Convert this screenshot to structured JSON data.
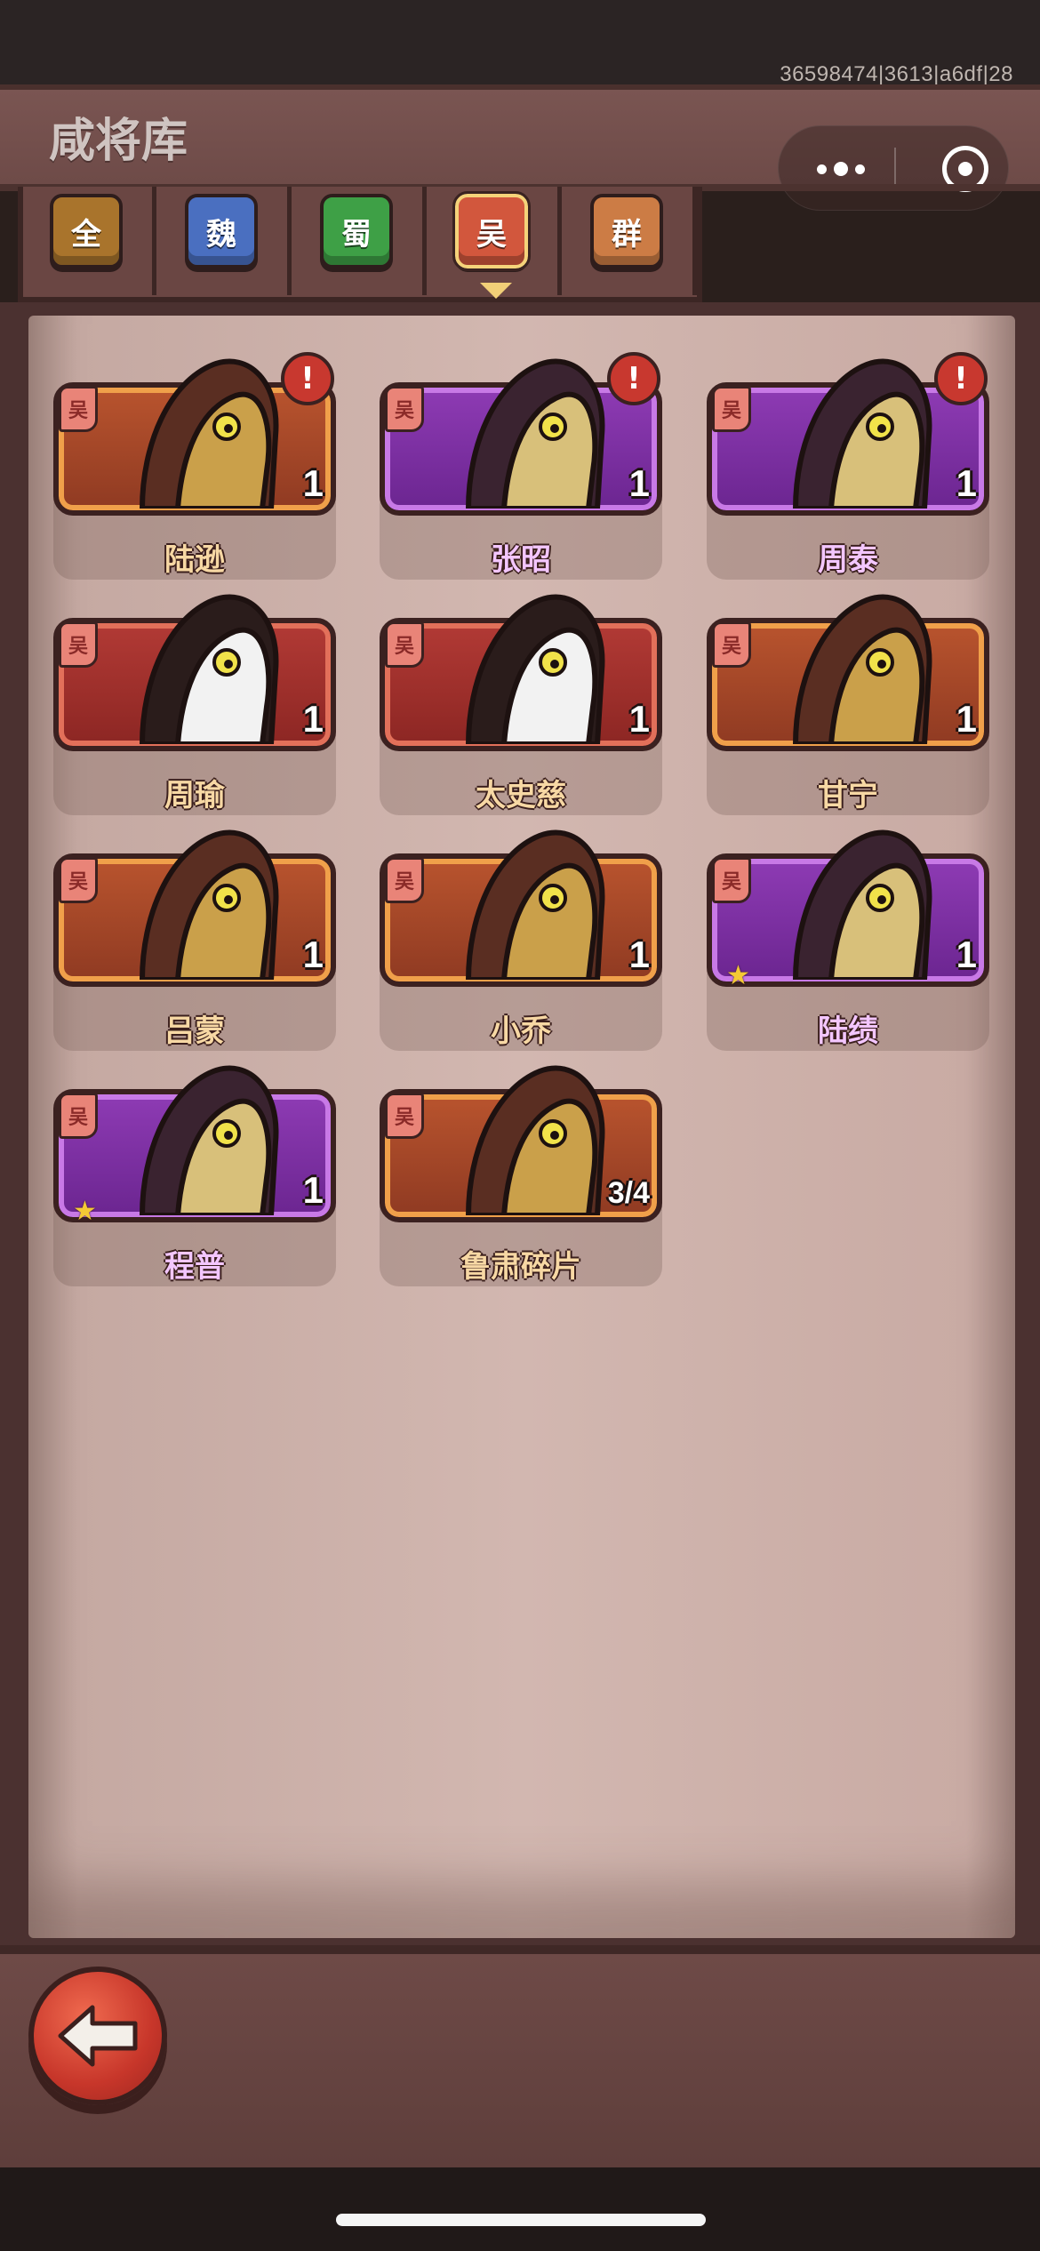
{
  "status": {
    "build_id": "36598474|3613|a6df|28"
  },
  "header": {
    "title": "咸将库"
  },
  "tabs": [
    {
      "label": "全",
      "color": "#a9742c",
      "active": false
    },
    {
      "label": "魏",
      "color": "#4a6fc0",
      "active": false
    },
    {
      "label": "蜀",
      "color": "#3ea046",
      "active": false
    },
    {
      "label": "吴",
      "color": "#d2573d",
      "active": true
    },
    {
      "label": "群",
      "color": "#cc7c45",
      "active": false
    }
  ],
  "cards": [
    {
      "name": "陆逊",
      "kingdom": "吴",
      "count": "1",
      "frame": "orange",
      "alert": "!",
      "star": false
    },
    {
      "name": "张昭",
      "kingdom": "吴",
      "count": "1",
      "frame": "purple",
      "alert": "!",
      "star": false
    },
    {
      "name": "周泰",
      "kingdom": "吴",
      "count": "1",
      "frame": "purple",
      "alert": "!",
      "star": false
    },
    {
      "name": "周瑜",
      "kingdom": "吴",
      "count": "1",
      "frame": "red",
      "alert": "",
      "star": false
    },
    {
      "name": "太史慈",
      "kingdom": "吴",
      "count": "1",
      "frame": "red",
      "alert": "",
      "star": false
    },
    {
      "name": "甘宁",
      "kingdom": "吴",
      "count": "1",
      "frame": "orange",
      "alert": "",
      "star": false
    },
    {
      "name": "吕蒙",
      "kingdom": "吴",
      "count": "1",
      "frame": "orange",
      "alert": "",
      "star": false
    },
    {
      "name": "小乔",
      "kingdom": "吴",
      "count": "1",
      "frame": "orange",
      "alert": "",
      "star": false
    },
    {
      "name": "陆绩",
      "kingdom": "吴",
      "count": "1",
      "frame": "purple",
      "alert": "",
      "star": true
    },
    {
      "name": "程普",
      "kingdom": "吴",
      "count": "1",
      "frame": "purple",
      "alert": "",
      "star": true
    },
    {
      "name": "鲁肃碎片",
      "kingdom": "吴",
      "count": "3/4",
      "frame": "orange",
      "alert": "",
      "star": false
    }
  ],
  "footer": {
    "back_icon": "back-arrow-icon"
  }
}
